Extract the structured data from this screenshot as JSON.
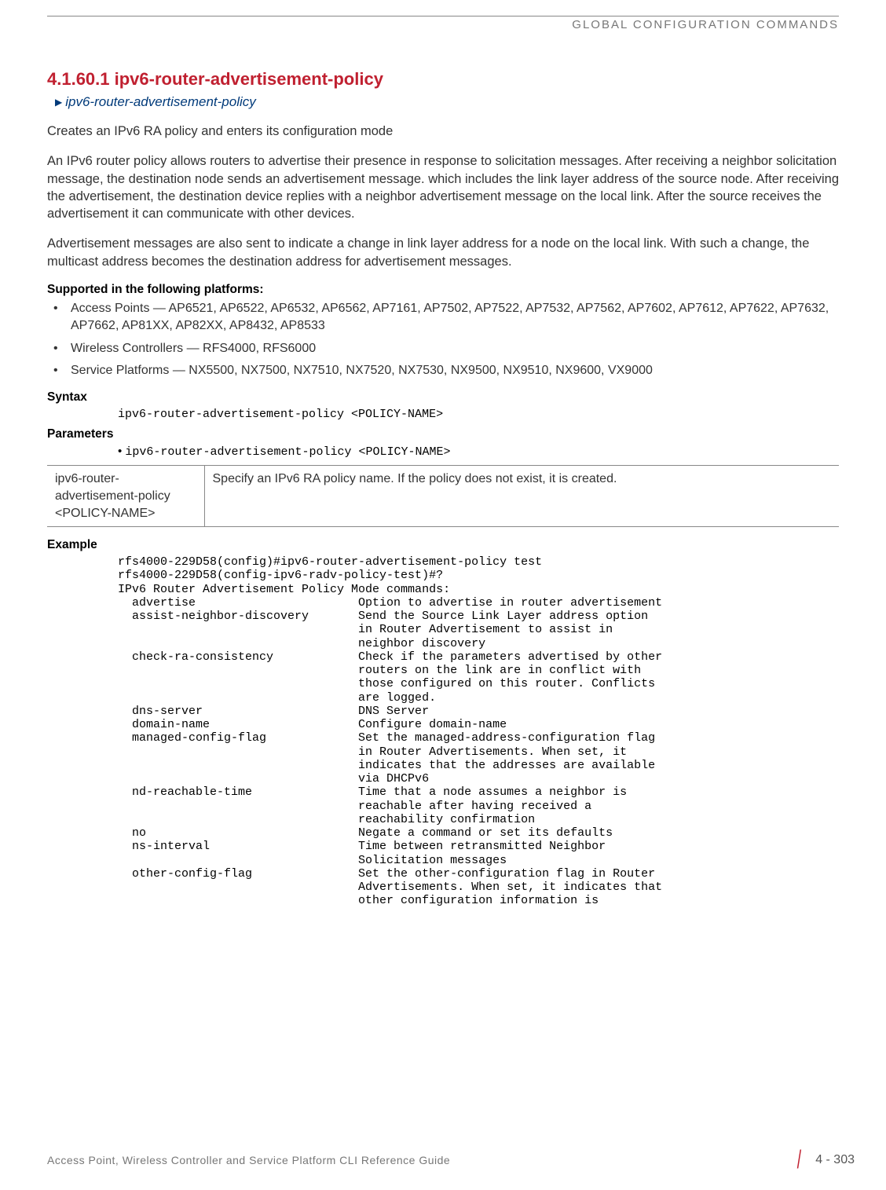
{
  "header": {
    "label": "GLOBAL CONFIGURATION COMMANDS"
  },
  "section": {
    "number_title": "4.1.60.1 ipv6-router-advertisement-policy",
    "breadcrumb": "ipv6-router-advertisement-policy",
    "intro": "Creates an IPv6 RA policy and enters its configuration mode",
    "para1": "An IPv6 router policy allows routers to advertise their presence in response to solicitation messages. After receiving a neighbor solicitation message, the destination node sends an advertisement message. which includes the link layer address of the source node. After receiving the advertisement, the destination device replies with a neighbor advertisement message on the local link. After the source receives the advertisement it can communicate with other devices.",
    "para2": "Advertisement messages are also sent to indicate a change in link layer address for a node on the local link. With such a change, the multicast address becomes the destination address for advertisement messages."
  },
  "supported": {
    "heading": "Supported in the following platforms:",
    "items": [
      "Access Points — AP6521, AP6522, AP6532, AP6562, AP7161, AP7502, AP7522, AP7532, AP7562, AP7602, AP7612, AP7622, AP7632, AP7662, AP81XX, AP82XX, AP8432, AP8533",
      "Wireless Controllers — RFS4000, RFS6000",
      "Service Platforms — NX5500, NX7500, NX7510, NX7520, NX7530, NX9500, NX9510, NX9600, VX9000"
    ]
  },
  "syntax": {
    "heading": "Syntax",
    "code": "ipv6-router-advertisement-policy <POLICY-NAME>"
  },
  "parameters": {
    "heading": "Parameters",
    "code": "ipv6-router-advertisement-policy <POLICY-NAME>",
    "table": {
      "col1": "ipv6-router-advertisement-policy <POLICY-NAME>",
      "col2": "Specify an IPv6 RA policy name. If the policy does not exist, it is created."
    }
  },
  "example": {
    "heading": "Example",
    "text": "rfs4000-229D58(config)#ipv6-router-advertisement-policy test\nrfs4000-229D58(config-ipv6-radv-policy-test)#?\nIPv6 Router Advertisement Policy Mode commands:\n  advertise                       Option to advertise in router advertisement\n  assist-neighbor-discovery       Send the Source Link Layer address option\n                                  in Router Advertisement to assist in\n                                  neighbor discovery\n  check-ra-consistency            Check if the parameters advertised by other\n                                  routers on the link are in conflict with\n                                  those configured on this router. Conflicts\n                                  are logged.\n  dns-server                      DNS Server\n  domain-name                     Configure domain-name\n  managed-config-flag             Set the managed-address-configuration flag\n                                  in Router Advertisements. When set, it\n                                  indicates that the addresses are available\n                                  via DHCPv6\n  nd-reachable-time               Time that a node assumes a neighbor is\n                                  reachable after having received a\n                                  reachability confirmation\n  no                              Negate a command or set its defaults\n  ns-interval                     Time between retransmitted Neighbor\n                                  Solicitation messages\n  other-config-flag               Set the other-configuration flag in Router\n                                  Advertisements. When set, it indicates that\n                                  other configuration information is"
  },
  "footer": {
    "left": "Access Point, Wireless Controller and Service Platform CLI Reference Guide",
    "page": "4 - 303"
  }
}
